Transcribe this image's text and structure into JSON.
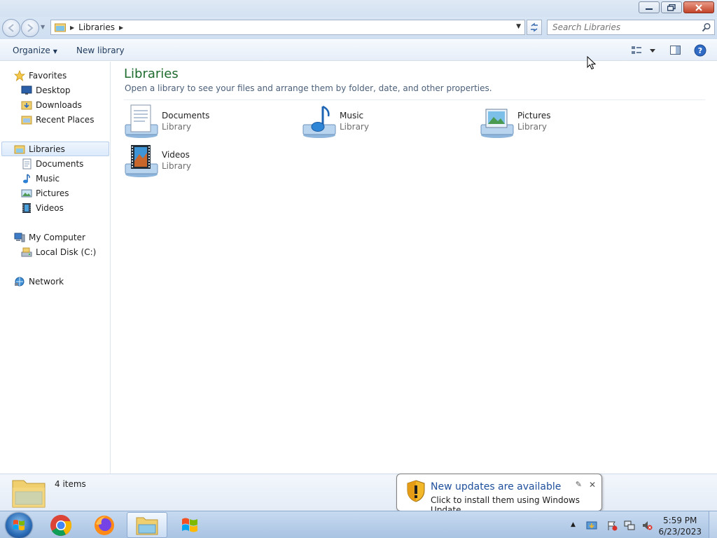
{
  "window": {
    "buttons": {
      "minimize": "minimize",
      "restore": "restore",
      "close": "close"
    }
  },
  "address": {
    "path": "Libraries",
    "search_placeholder": "Search Libraries"
  },
  "toolbar": {
    "organize_label": "Organize",
    "new_library_label": "New library"
  },
  "sidebar": {
    "favorites": {
      "label": "Favorites",
      "items": [
        "Desktop",
        "Downloads",
        "Recent Places"
      ]
    },
    "libraries": {
      "label": "Libraries",
      "items": [
        "Documents",
        "Music",
        "Pictures",
        "Videos"
      ]
    },
    "computer": {
      "label": "My Computer",
      "items": [
        "Local Disk (C:)"
      ]
    },
    "network": {
      "label": "Network"
    }
  },
  "main": {
    "title": "Libraries",
    "subtitle": "Open a library to see your files and arrange them by folder, date, and other properties.",
    "libraries": [
      {
        "name": "Documents",
        "type": "Library"
      },
      {
        "name": "Music",
        "type": "Library"
      },
      {
        "name": "Pictures",
        "type": "Library"
      },
      {
        "name": "Videos",
        "type": "Library"
      }
    ]
  },
  "details": {
    "count": "4 items"
  },
  "notification": {
    "title": "New updates are available",
    "text": "Click to install them using Windows Update."
  },
  "taskbar": {
    "time": "5:59 PM",
    "date": "6/23/2023"
  }
}
